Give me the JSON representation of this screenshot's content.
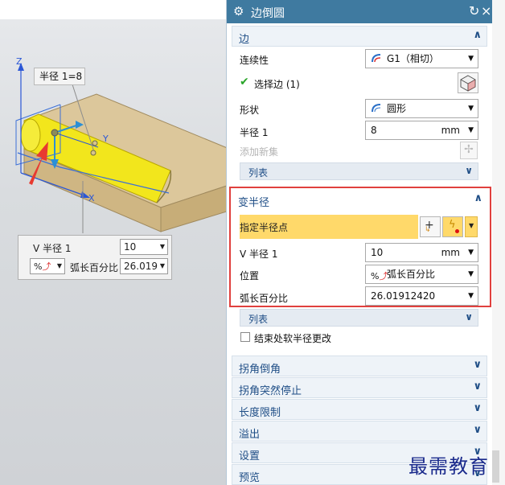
{
  "viewport": {
    "radius_tag": "半径 1=8",
    "axis_z": "Z",
    "axis_y": "Y",
    "axis_x": "X",
    "vr_panel": {
      "v_radius_label": "V 半径 1",
      "v_radius_value": "10",
      "position_label": "弧长百分比",
      "position_value": "26.019",
      "position_icon": "percent-arc-icon"
    }
  },
  "dialog": {
    "title": "边倒圆",
    "sections": {
      "edge": {
        "title": "边",
        "continuity_label": "连续性",
        "continuity_value": "G1（相切）",
        "select_edge_label": "选择边 (1)",
        "shape_label": "形状",
        "shape_value": "圆形",
        "radius_label": "半径 1",
        "radius_value": "8",
        "radius_unit": "mm",
        "add_new_set": "添加新集",
        "list_label": "列表"
      },
      "variable_radius": {
        "title": "变半径",
        "specify_point_label": "指定半径点",
        "v_radius_label": "V 半径 1",
        "v_radius_value": "10",
        "v_radius_unit": "mm",
        "position_label": "位置",
        "position_value": "弧长百分比",
        "arc_percent_label": "弧长百分比",
        "arc_percent_value": "26.01912420",
        "list_label": "列表",
        "soft_change_label": "结束处软半径更改"
      },
      "collapsed": [
        "拐角倒角",
        "拐角突然停止",
        "长度限制",
        "溢出",
        "设置",
        "预览"
      ]
    }
  },
  "watermark": "最需教育",
  "colors": {
    "title_bar": "#3f7aa0",
    "section_text": "#1f4e86",
    "highlight_border": "#e0403e",
    "selected_row": "#ffd96a",
    "part_yellow": "#f2e61c",
    "part_tan": "#d6c08f"
  }
}
